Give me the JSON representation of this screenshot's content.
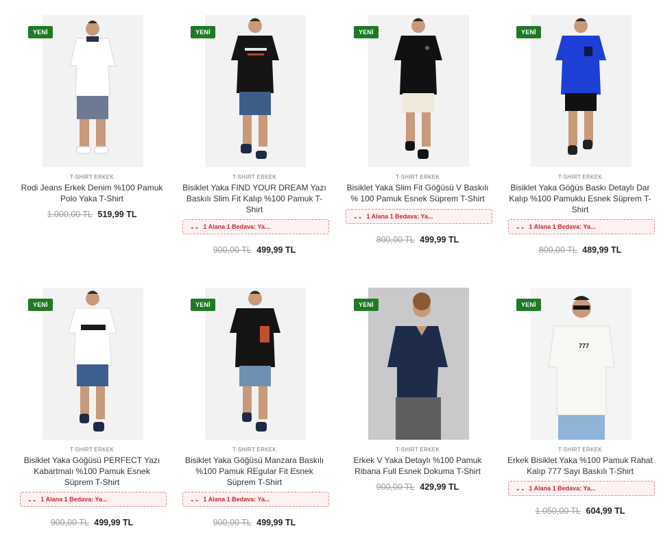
{
  "colors": {
    "badge": "#1e7a23",
    "promo_text": "#c62828",
    "promo_bg": "#fdf1f1"
  },
  "products": [
    {
      "badge": "YENİ",
      "category": "T-SHIRT ERKEK",
      "title": "Rodi Jeans Erkek Denim %100 Pamuk Polo Yaka T-Shirt",
      "promo": "",
      "old_price": "1.000,00 TL",
      "new_price": "519,99 TL",
      "image_icon": "model-white-polo-shirt"
    },
    {
      "badge": "YENİ",
      "category": "T-SHIRT ERKEK",
      "title": "Bisiklet Yaka FIND YOUR DREAM Yazı Baskılı Slim Fit Kalıp %100 Pamuk T-Shirt",
      "promo": "1 Alana 1 Bedava: Ya...",
      "old_price": "900,00 TL",
      "new_price": "499,99 TL",
      "image_icon": "model-black-printed-tshirt"
    },
    {
      "badge": "YENİ",
      "category": "T-SHIRT ERKEK",
      "title": "Bisiklet Yaka Slim Fit Göğüsü V Baskılı % 100 Pamuk Esnek Süprem T-Shirt",
      "promo": "1 Alana 1 Bedava: Ya...",
      "old_price": "800,00 TL",
      "new_price": "499,99 TL",
      "image_icon": "model-black-tshirt"
    },
    {
      "badge": "YENİ",
      "category": "T-SHIRT ERKEK",
      "title": "Bisiklet Yaka Göğüs Baskı Detaylı Dar Kalıp %100 Pamuklu Esnek Süprem T-Shirt",
      "promo": "1 Alana 1 Bedava: Ya...",
      "old_price": "800,00 TL",
      "new_price": "489,99 TL",
      "image_icon": "model-blue-tshirt"
    },
    {
      "badge": "YENİ",
      "category": "T-SHIRT ERKEK",
      "title": "Bisiklet Yaka Göğüsü PERFECT Yazı Kabartmalı %100 Pamuk Esnek Süprem T-Shirt",
      "promo": "1 Alana 1 Bedava: Ya...",
      "old_price": "900,00 TL",
      "new_price": "499,99 TL",
      "image_icon": "model-white-perfect-tshirt"
    },
    {
      "badge": "YENİ",
      "category": "T-SHIRT ERKEK",
      "title": "Bisiklet Yaka Göğüsü Manzara Baskılı %100 Pamuk REgular Fit Esnek Süprem T-Shirt",
      "promo": "1 Alana 1 Bedava: Ya...",
      "old_price": "900,00 TL",
      "new_price": "499,99 TL",
      "image_icon": "model-black-landscape-tshirt"
    },
    {
      "badge": "YENİ",
      "category": "T-SHIRT ERKEK",
      "title": "Erkek V Yaka Detaylı %100 Pamuk Ribana Full Esnek Dokuma T-Shirt",
      "promo": "",
      "old_price": "900,00 TL",
      "new_price": "429,99 TL",
      "image_icon": "model-navy-vneck-tshirt"
    },
    {
      "badge": "YENİ",
      "category": "T-SHIRT ERKEK",
      "title": "Erkek Bisiklet Yaka %100 Pamuk Rahat Kalıp 777 Sayı Baskılı T-Shirt",
      "promo": "1 Alana 1 Bedava: Ya...",
      "old_price": "1.050,00 TL",
      "new_price": "604,99 TL",
      "image_icon": "model-white-777-tshirt"
    }
  ]
}
